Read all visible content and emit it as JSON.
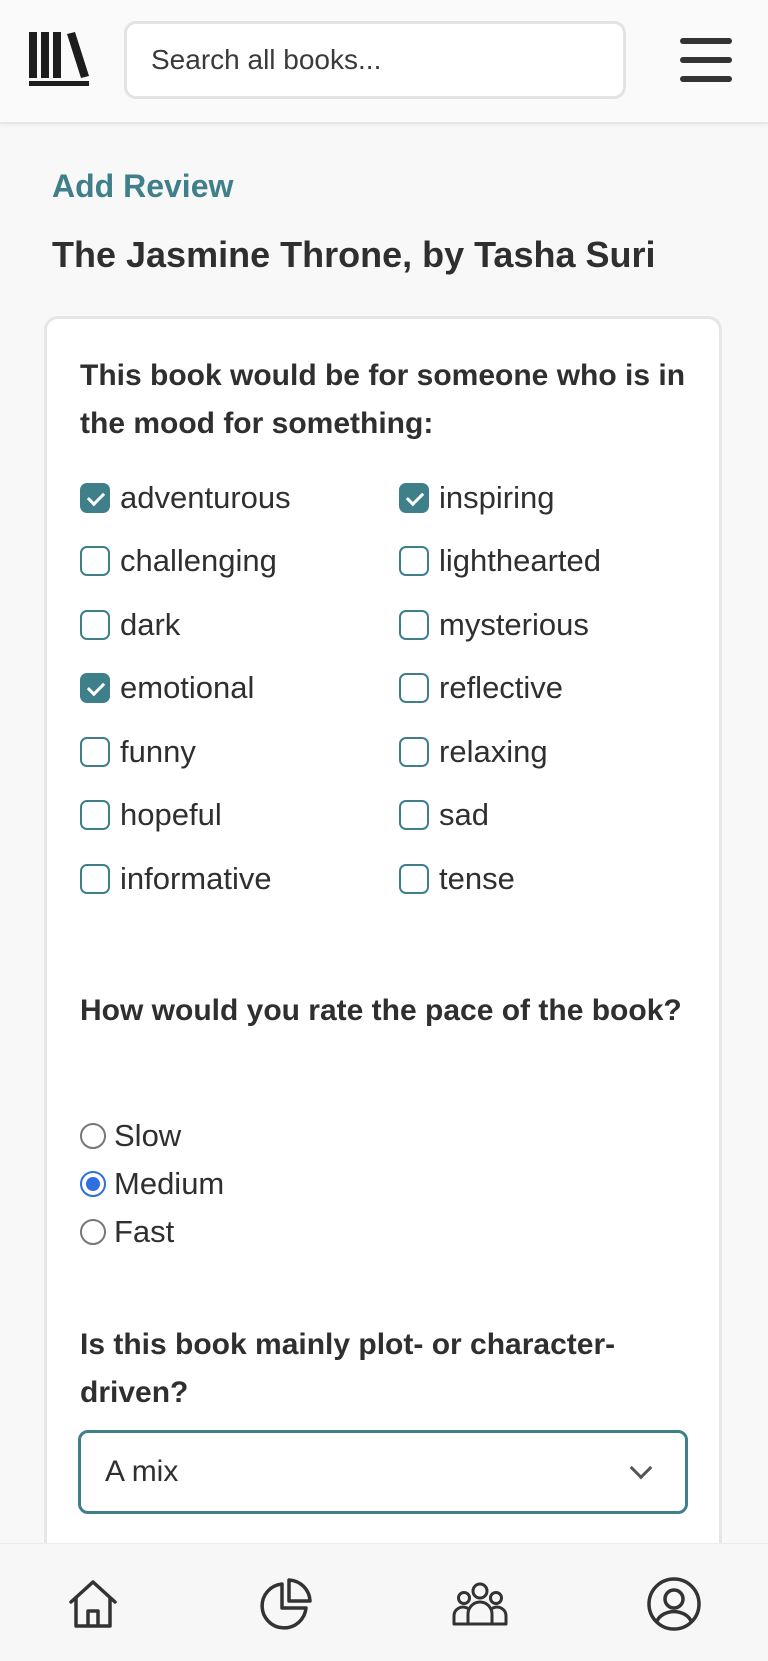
{
  "header": {
    "search_placeholder": "Search all books..."
  },
  "breadcrumb": "Add Review",
  "book_title": "The Jasmine Throne, by Tasha Suri",
  "mood_question": "This book would be for someone who is in the mood for something:",
  "moods": [
    {
      "label": "adventurous",
      "checked": true
    },
    {
      "label": "challenging",
      "checked": false
    },
    {
      "label": "dark",
      "checked": false
    },
    {
      "label": "emotional",
      "checked": true
    },
    {
      "label": "funny",
      "checked": false
    },
    {
      "label": "hopeful",
      "checked": false
    },
    {
      "label": "informative",
      "checked": false
    },
    {
      "label": "inspiring",
      "checked": true
    },
    {
      "label": "lighthearted",
      "checked": false
    },
    {
      "label": "mysterious",
      "checked": false
    },
    {
      "label": "reflective",
      "checked": false
    },
    {
      "label": "relaxing",
      "checked": false
    },
    {
      "label": "sad",
      "checked": false
    },
    {
      "label": "tense",
      "checked": false
    }
  ],
  "pace_question": "How would you rate the pace of the book?",
  "pace_options": [
    {
      "label": "Slow",
      "checked": false
    },
    {
      "label": "Medium",
      "checked": true
    },
    {
      "label": "Fast",
      "checked": false
    }
  ],
  "driven_question": "Is this book mainly plot- or character-driven?",
  "driven_select": {
    "value": "A mix"
  },
  "colors": {
    "accent": "#3e7f8a",
    "radio_selected": "#2f6fe0"
  },
  "bottom_nav": [
    "home-icon",
    "stats-pie-icon",
    "community-icon",
    "profile-icon"
  ]
}
